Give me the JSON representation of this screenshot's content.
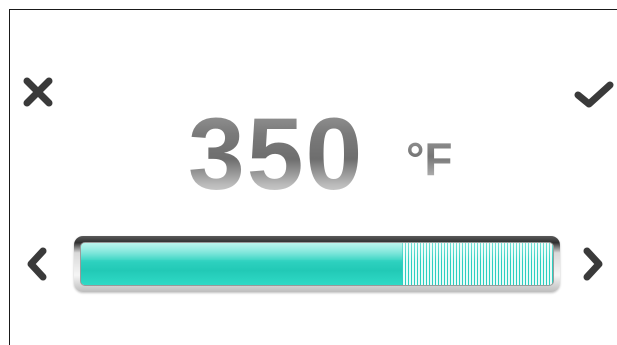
{
  "temperature": {
    "value": "350",
    "unit": "°F"
  },
  "slider": {
    "level_fraction": 0.68,
    "accent_color": "#2bcfc0"
  },
  "icons": {
    "cancel": "close-icon",
    "confirm": "checkmark-icon",
    "decrease": "chevron-left-icon",
    "increase": "chevron-right-icon"
  }
}
